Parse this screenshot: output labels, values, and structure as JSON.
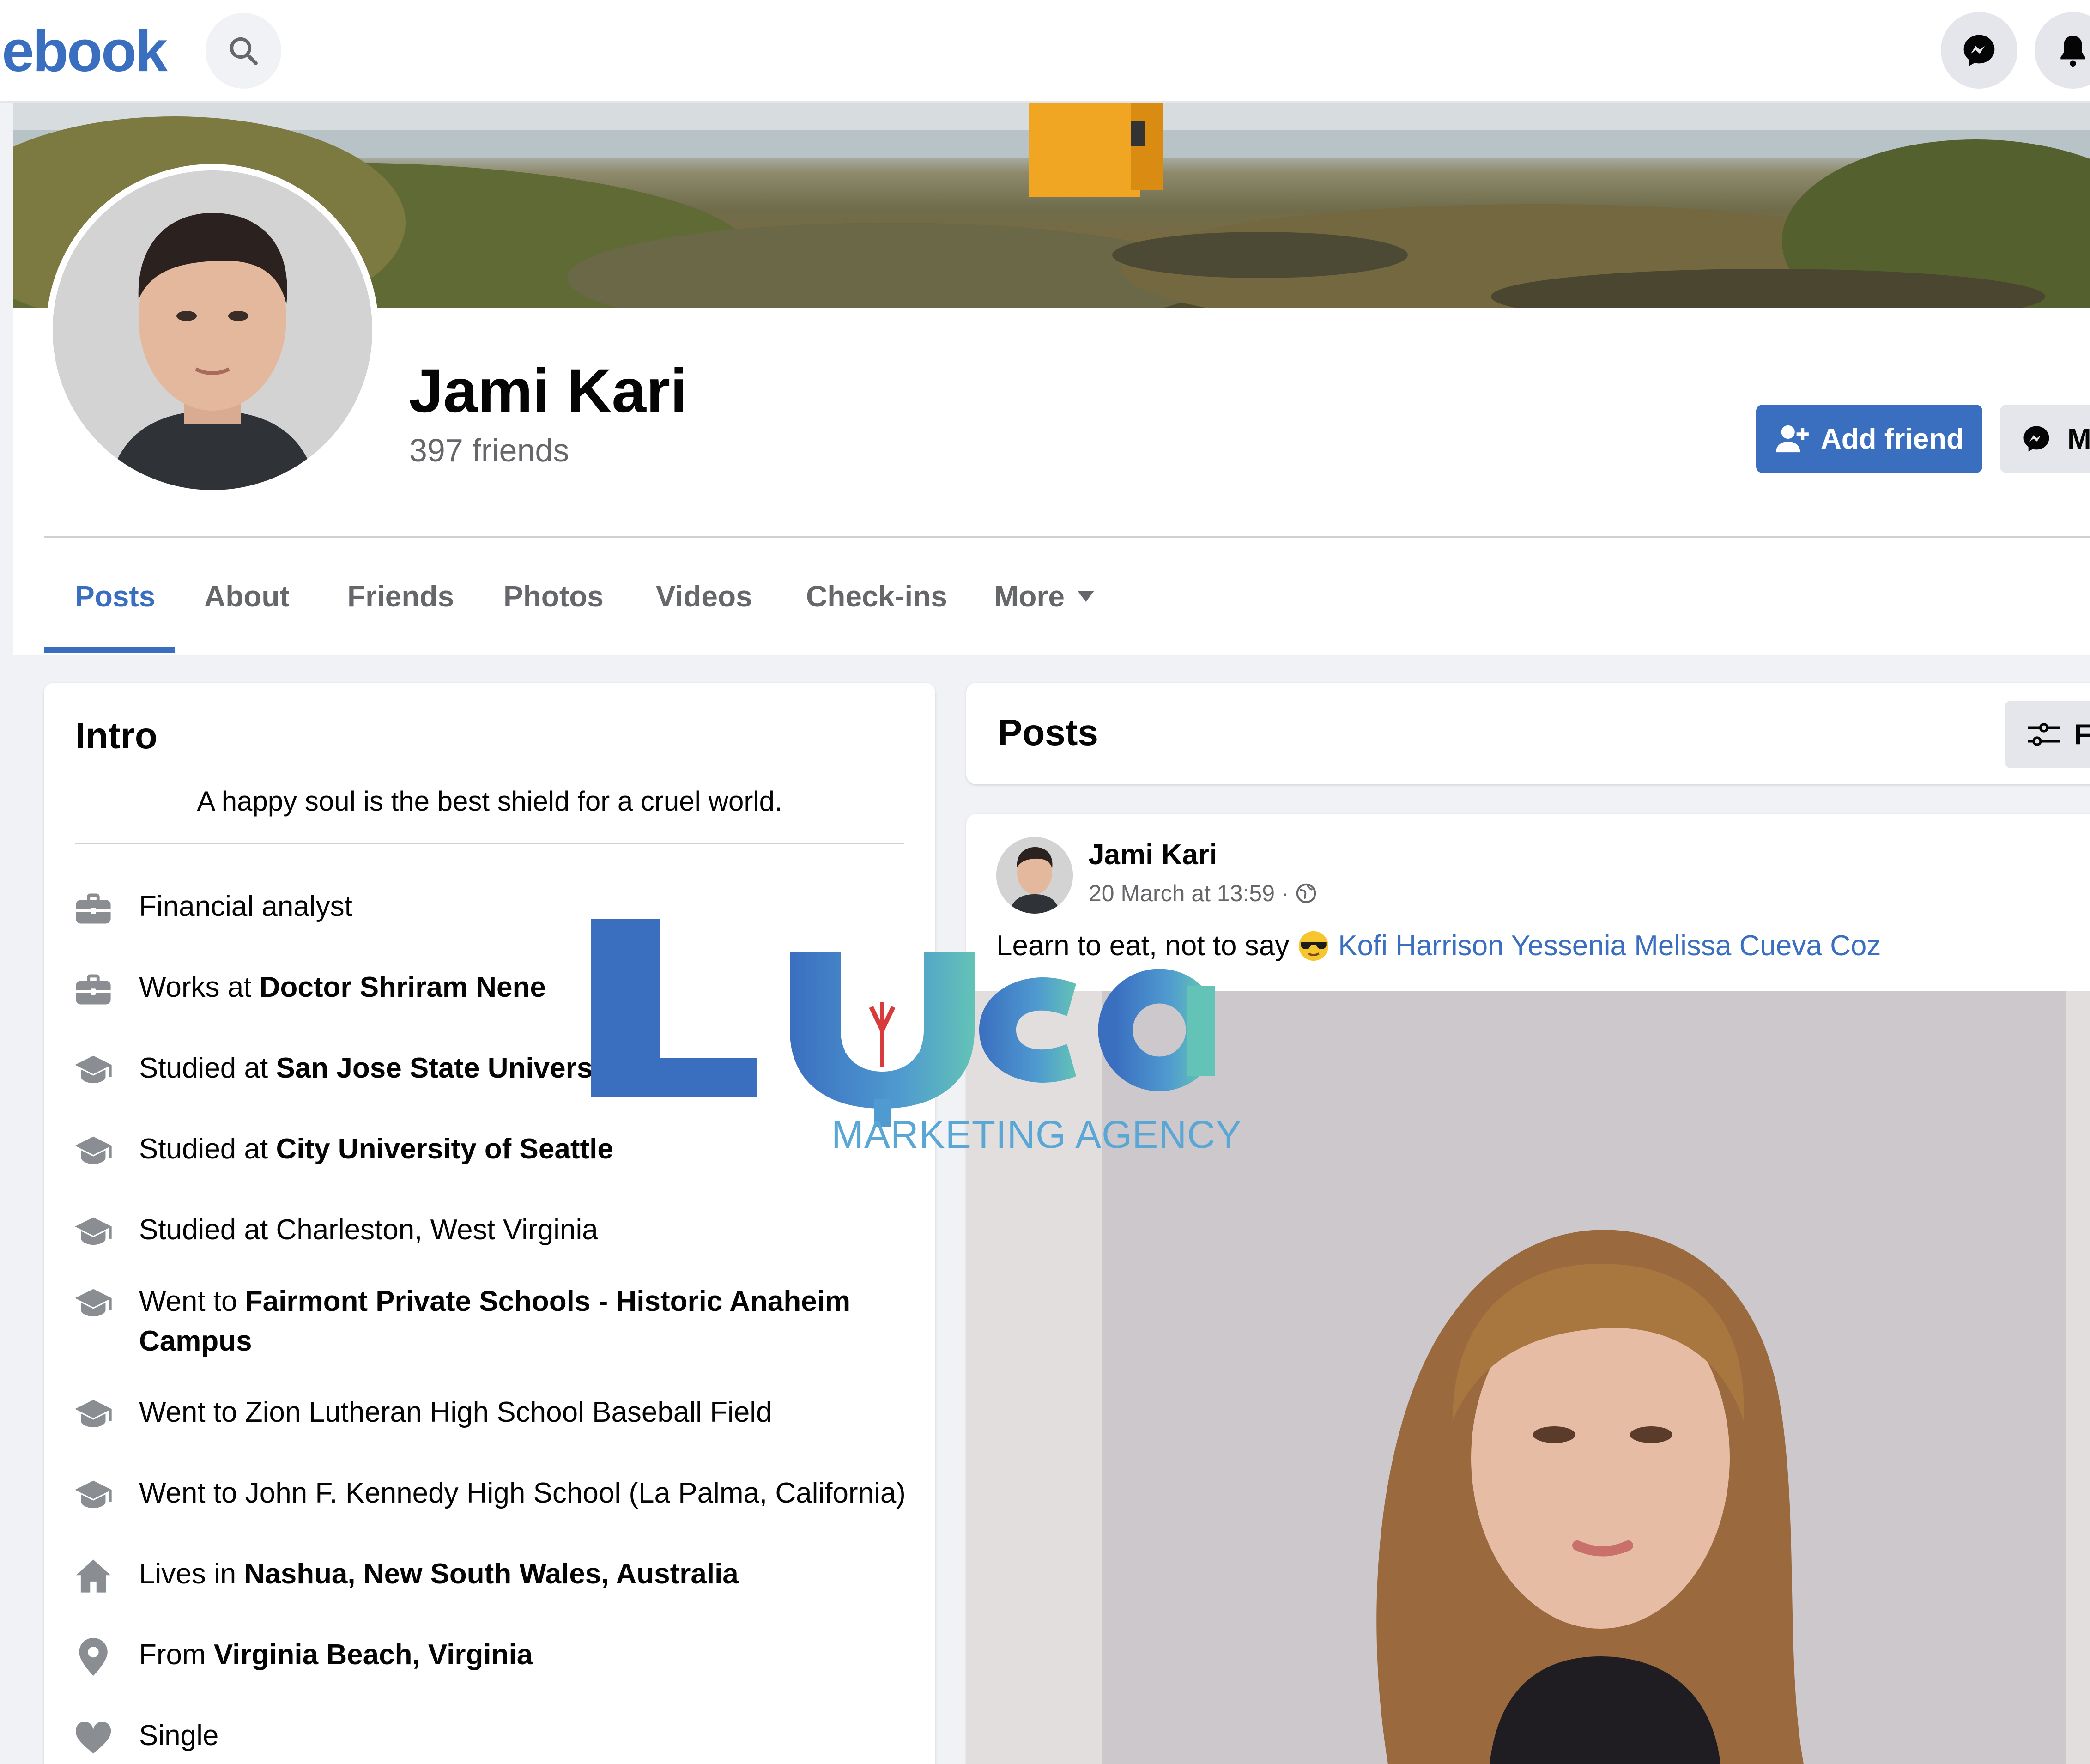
{
  "topbar": {
    "logo_text": "ebook",
    "search_icon": "search-icon",
    "messenger_icon": "messenger-icon",
    "notifications_icon": "bell-icon"
  },
  "profile": {
    "name": "Jami Kari",
    "friends": "397 friends",
    "add_friend_label": "Add friend",
    "message_label": "M"
  },
  "tabs": [
    {
      "label": "Posts",
      "active": true
    },
    {
      "label": "About"
    },
    {
      "label": "Friends"
    },
    {
      "label": "Photos"
    },
    {
      "label": "Videos"
    },
    {
      "label": "Check-ins"
    },
    {
      "label": "More"
    }
  ],
  "intro": {
    "title": "Intro",
    "bio": "A happy soul is the best shield for a cruel world.",
    "items": [
      {
        "icon": "briefcase-icon",
        "prefix": "Financial analyst",
        "bold": ""
      },
      {
        "icon": "briefcase-icon",
        "prefix": "Works at ",
        "bold": "Doctor Shriram Nene"
      },
      {
        "icon": "graduation-cap-icon",
        "prefix": "Studied at ",
        "bold": "San Jose State University"
      },
      {
        "icon": "graduation-cap-icon",
        "prefix": "Studied at ",
        "bold": "City University of Seattle"
      },
      {
        "icon": "graduation-cap-icon",
        "prefix": "Studied at Charleston, West Virginia",
        "bold": ""
      },
      {
        "icon": "graduation-cap-icon",
        "prefix": "Went to ",
        "bold": "Fairmont Private Schools - Historic Anaheim Campus"
      },
      {
        "icon": "graduation-cap-icon",
        "prefix": "Went to Zion Lutheran High School Baseball Field",
        "bold": ""
      },
      {
        "icon": "graduation-cap-icon",
        "prefix": "Went to John F. Kennedy High School (La Palma, California)",
        "bold": ""
      },
      {
        "icon": "home-icon",
        "prefix": "Lives in ",
        "bold": "Nashua, New South Wales, Australia"
      },
      {
        "icon": "location-pin-icon",
        "prefix": "From ",
        "bold": "Virginia Beach, Virginia"
      },
      {
        "icon": "heart-icon",
        "prefix": "Single",
        "bold": ""
      }
    ]
  },
  "posts": {
    "title": "Posts",
    "filters_label": "Fi",
    "post": {
      "author": "Jami Kari",
      "meta": "20 March at 13:59 ·",
      "text": "Learn to eat, not to say",
      "tags": "Kofi Harrison Yessenia Melissa Cueva Coz"
    }
  },
  "watermark": {
    "brand": "Luca",
    "subtitle": "MARKETING AGENCY"
  },
  "colors": {
    "accent": "#3a6fc0",
    "muted_text": "#65676b",
    "background": "#f0f2f5"
  }
}
